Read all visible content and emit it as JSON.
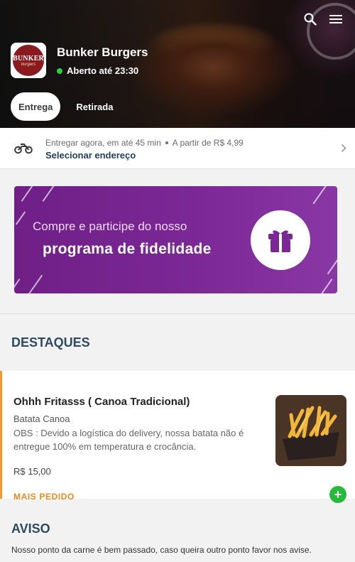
{
  "store": {
    "name": "Bunker Burgers",
    "status": "Aberto até 23:30",
    "logo_text": "BUNKER",
    "logo_sub": "burgers"
  },
  "hero_tabs": [
    {
      "label": "Entrega",
      "active": true
    },
    {
      "label": "Retirada",
      "active": false
    }
  ],
  "address": {
    "delivery_time": "Entregar agora, em até 45 min",
    "min_price": "A partir de R$ 4,99",
    "select_label": "Selecionar endereço"
  },
  "banner": {
    "line1": "Compre e participe do nosso",
    "line2": "programa de fidelidade"
  },
  "highlights": {
    "title": "DESTAQUES",
    "product": {
      "name": "Ohhh Fritasss ( Canoa Tradicional)",
      "subtitle": "Batata Canoa",
      "description": "OBS : Devido a logística do delivery, nossa batata não é entregue 100% em temperatura e crocância.",
      "price": "R$ 15,00",
      "tag": "MAIS PEDIDO",
      "add_label": "+"
    }
  },
  "notice": {
    "title": "AVISO",
    "text": "Nosso ponto da carne é bem passado, caso queira outro ponto favor nos avise."
  },
  "colors": {
    "accent_orange": "#f29a2e",
    "open_green": "#2ecc40",
    "add_green": "#28b83c",
    "banner_purple": "#7b2896",
    "title_navy": "#2e4a5f"
  },
  "icons": {
    "search": "search-icon",
    "menu": "menu-icon",
    "delivery": "motorcycle-icon",
    "chevron": "chevron-right-icon",
    "gift": "gift-icon"
  }
}
